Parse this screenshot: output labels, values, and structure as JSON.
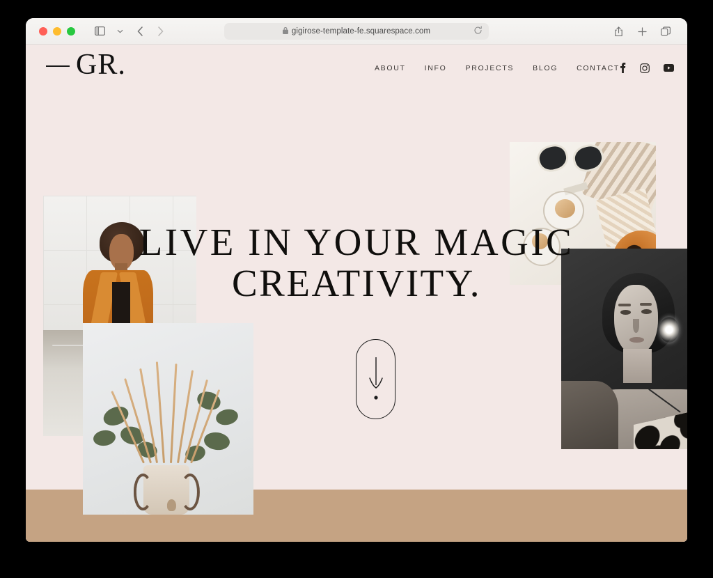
{
  "browser": {
    "url": "gigirose-template-fe.squarespace.com",
    "lock_icon": "lock-icon",
    "reload_icon": "reload-icon",
    "traffic_lights": [
      "close",
      "minimize",
      "maximize"
    ],
    "nav": {
      "sidebar_icon": "sidebar-toggle-icon",
      "dropdown_icon": "chevron-down-icon",
      "back_icon": "back-chevron-icon",
      "forward_icon": "forward-chevron-icon"
    },
    "actions": {
      "share_icon": "share-icon",
      "new_tab_icon": "plus-icon",
      "tab_overview_icon": "tab-overview-icon"
    }
  },
  "site": {
    "logo": {
      "dash": "—",
      "mark": "GR."
    },
    "nav_items": [
      {
        "label": "ABOUT"
      },
      {
        "label": "INFO"
      },
      {
        "label": "PROJECTS"
      },
      {
        "label": "BLOG"
      },
      {
        "label": "CONTACT"
      }
    ],
    "social": [
      {
        "name": "facebook-icon",
        "glyph": "f"
      },
      {
        "name": "instagram-icon",
        "glyph": "instagram"
      },
      {
        "name": "youtube-icon",
        "glyph": "youtube"
      }
    ],
    "hero": {
      "line1": "LIVE IN YOUR MAGIC",
      "line2": "CREATIVITY.",
      "scroll_indicator": "scroll-down-arrow"
    },
    "images": [
      {
        "name": "image-model-coat",
        "alt": "Woman in mustard trench coat on concrete steps"
      },
      {
        "name": "image-pampas-vase",
        "alt": "Dried pampas grass and eucalyptus in ceramic vase"
      },
      {
        "name": "image-flatlay-accessories",
        "alt": "Flat lay of sunglasses, jewelry and striped textile"
      },
      {
        "name": "image-portrait-bw",
        "alt": "Black and white portrait of woman with starburst earring"
      }
    ],
    "colors": {
      "background": "#F3E8E6",
      "band": "#C5A383",
      "text": "#100F0D",
      "accent_coat": "#C8731D"
    }
  }
}
